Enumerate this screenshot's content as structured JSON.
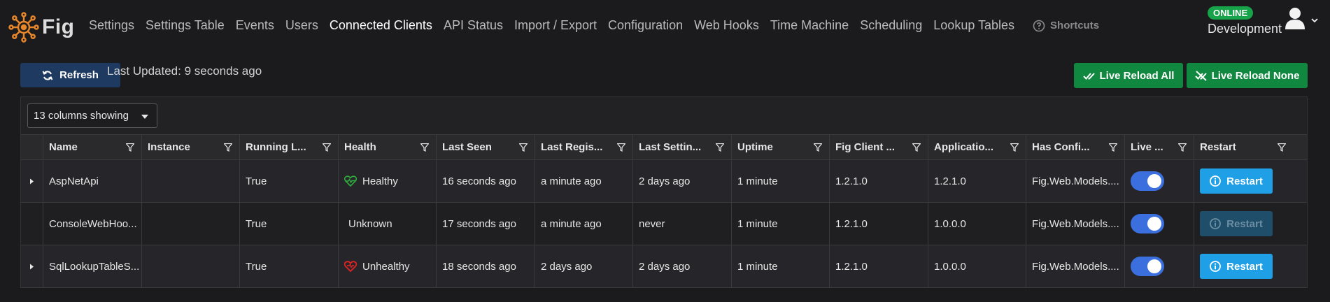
{
  "app": {
    "brand_name": "Fig",
    "nav_links": [
      "Settings",
      "Settings Table",
      "Events",
      "Users",
      "Connected Clients",
      "API Status",
      "Import / Export",
      "Configuration",
      "Web Hooks",
      "Time Machine",
      "Scheduling",
      "Lookup Tables"
    ],
    "active_nav": "Connected Clients",
    "shortcuts_label": "Shortcuts",
    "status_badge": "ONLINE",
    "environment": "Development"
  },
  "toolbar": {
    "refresh_label": "Refresh",
    "last_updated": "Last Updated: 9 seconds ago",
    "live_reload_all_label": "Live Reload All",
    "live_reload_none_label": "Live Reload None"
  },
  "grid": {
    "columns_showing": "13 columns showing",
    "headers": [
      "Name",
      "Instance",
      "Running L...",
      "Health",
      "Last Seen",
      "Last Regis...",
      "Last Settin...",
      "Uptime",
      "Fig Client ...",
      "Applicatio...",
      "Has Confi...",
      "Live ...",
      "Restart"
    ],
    "rows": [
      {
        "expandable": true,
        "name": "AspNetApi",
        "instance": "",
        "running_locally": "True",
        "health": "Healthy",
        "health_icon": "heart-pulse-icon",
        "last_seen": "16 seconds ago",
        "last_registration": "a minute ago",
        "last_settings": "2 days ago",
        "uptime": "1 minute",
        "fig_client_version": "1.2.1.0",
        "application_version": "1.2.1.0",
        "has_config": "Fig.Web.Models....",
        "live_reload": true,
        "restart_label": "Restart",
        "restart_enabled": true
      },
      {
        "expandable": false,
        "name": "ConsoleWebHoo...",
        "instance": "",
        "running_locally": "True",
        "health": "Unknown",
        "health_icon": "",
        "last_seen": "17 seconds ago",
        "last_registration": "a minute ago",
        "last_settings": "never",
        "uptime": "1 minute",
        "fig_client_version": "1.2.1.0",
        "application_version": "1.0.0.0",
        "has_config": "Fig.Web.Models....",
        "live_reload": true,
        "restart_label": "Restart",
        "restart_enabled": false
      },
      {
        "expandable": true,
        "name": "SqlLookupTableS...",
        "instance": "",
        "running_locally": "True",
        "health": "Unhealthy",
        "health_icon": "heart-broken-icon",
        "last_seen": "18 seconds ago",
        "last_registration": "2 days ago",
        "last_settings": "2 days ago",
        "uptime": "1 minute",
        "fig_client_version": "1.2.1.0",
        "application_version": "1.0.0.0",
        "has_config": "Fig.Web.Models....",
        "live_reload": true,
        "restart_label": "Restart",
        "restart_enabled": true
      }
    ]
  },
  "colors": {
    "accent_blue": "#3b6fde",
    "green": "#10883f",
    "healthy": "#2fae3b",
    "unhealthy": "#e02424",
    "restart": "#1e9fe6"
  }
}
